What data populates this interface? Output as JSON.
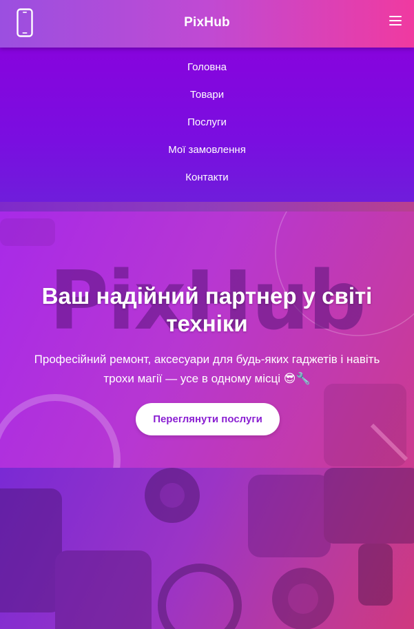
{
  "header": {
    "brand": "PixHub",
    "logo_icon": "smartphone-icon",
    "menu_icon": "hamburger-icon"
  },
  "nav": {
    "items": [
      {
        "label": "Головна"
      },
      {
        "label": "Товари"
      },
      {
        "label": "Послуги"
      },
      {
        "label": "Мої замовлення"
      },
      {
        "label": "Контакти"
      }
    ]
  },
  "hero": {
    "watermark": "PixHub",
    "title": "Ваш надійний партнер у світі техніки",
    "subtitle": "Професійний ремонт, аксесуари для будь-яких гаджетів і навіть трохи магії — усе в одному місці 😎🔧",
    "cta_label": "Переглянути послуги"
  },
  "colors": {
    "accent": "#8a1fd2",
    "header_start": "#9b4fe0",
    "header_end": "#f03aa0",
    "nav_bg": "#8704dd"
  }
}
